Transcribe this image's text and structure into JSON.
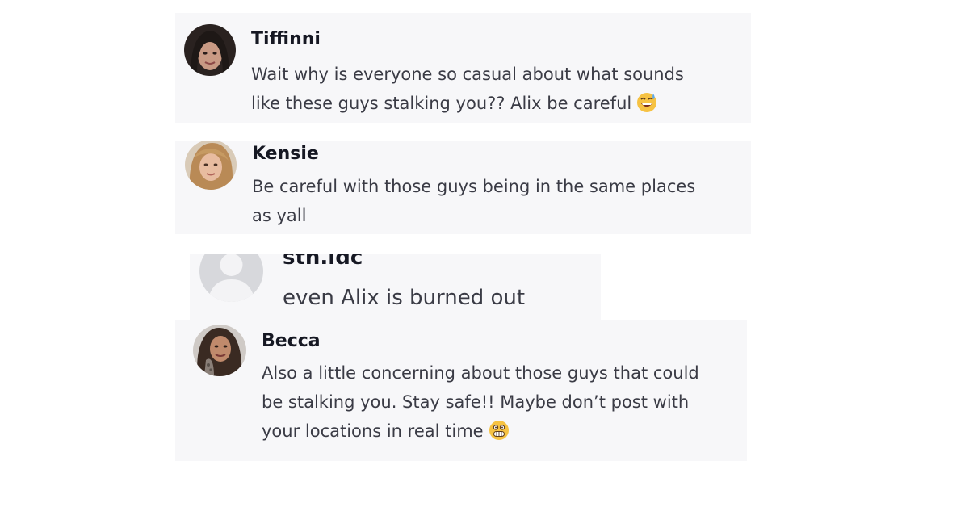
{
  "comments": [
    {
      "username": "Tiffinni",
      "lines": [
        "Wait why is everyone so casual about what sounds",
        "like these guys stalking you?? Alix be careful"
      ],
      "emoji": "grinning-sweat-emoji-icon"
    },
    {
      "username": "Kensie",
      "lines": [
        "Be careful with those guys being in the same places",
        "as yall"
      ]
    },
    {
      "username": "sth.idc",
      "lines": [
        "even Alix is burned out"
      ],
      "avatar": "default-avatar-icon"
    },
    {
      "username": "Becca",
      "lines": [
        "Also a little concerning about those guys that could",
        "be stalking you. Stay safe!! Maybe don’t post with",
        "your locations in real time"
      ],
      "emoji": "grimacing-emoji-icon"
    }
  ],
  "colors": {
    "card_background": "#f7f7f9",
    "username": "#161823",
    "comment_text": "#3a3b45",
    "default_avatar": "#c9cbd0"
  }
}
